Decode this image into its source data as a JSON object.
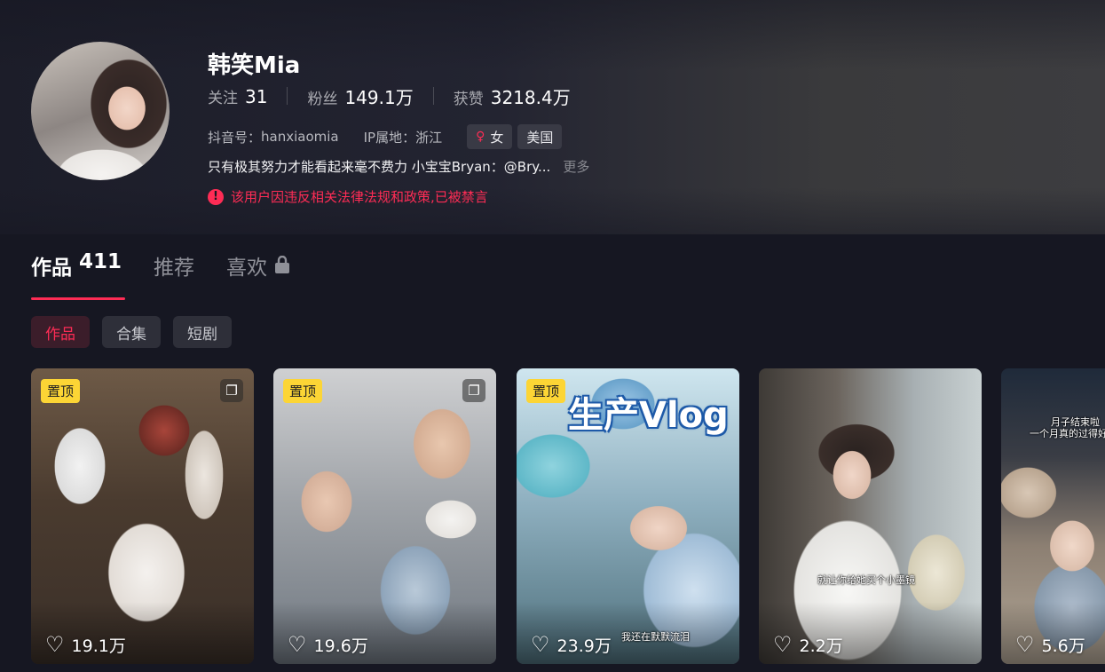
{
  "profile": {
    "name": "韩笑Mia",
    "stats": [
      {
        "label": "关注",
        "value": "31"
      },
      {
        "label": "粉丝",
        "value": "149.1万"
      },
      {
        "label": "获赞",
        "value": "3218.4万"
      }
    ],
    "douyin_id_label": "抖音号：",
    "douyin_id": "hanxiaomia",
    "ip_label": "IP属地：",
    "ip_location": "浙江",
    "gender": "女",
    "gender_icon": "female-icon",
    "country_tag": "美国",
    "bio": "只有极其努力才能看起来毫不费力 小宝宝Bryan：@Bry...",
    "more_label": "更多",
    "ban_notice": "该用户因违反相关法律法规和政策,已被禁言"
  },
  "tabs": [
    {
      "label": "作品",
      "count": "411",
      "active": true
    },
    {
      "label": "推荐",
      "count": "",
      "active": false
    },
    {
      "label": "喜欢",
      "count": "",
      "active": false,
      "icon": "lock-icon"
    }
  ],
  "filters": [
    {
      "label": "作品",
      "active": true
    },
    {
      "label": "合集",
      "active": false
    },
    {
      "label": "短剧",
      "active": false
    }
  ],
  "videos": [
    {
      "pinned_label": "置顶",
      "likes": "19.1万",
      "has_collection_icon": true
    },
    {
      "pinned_label": "置顶",
      "likes": "19.6万",
      "has_collection_icon": true
    },
    {
      "pinned_label": "置顶",
      "likes": "23.9万",
      "overlay_title": "生产Vlog",
      "caption": "我还在默默流泪"
    },
    {
      "likes": "2.2万",
      "caption": "就让你给她买个小墨镜"
    },
    {
      "likes": "5.6万",
      "caption_line1": "月子结束啦",
      "caption_line2": "一个月真的过得好快"
    }
  ],
  "colors": {
    "accent": "#fe2c55",
    "pin_badge": "#fcd535",
    "background": "#161722"
  }
}
